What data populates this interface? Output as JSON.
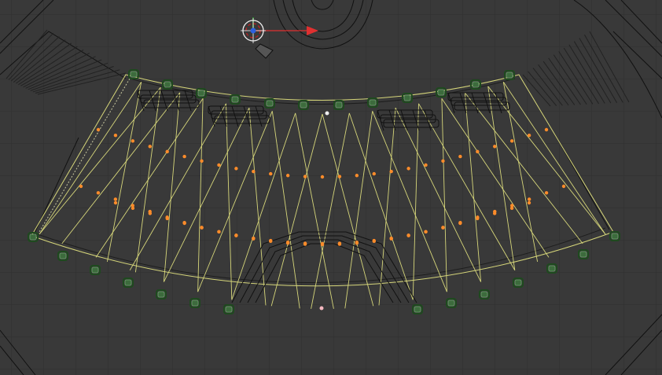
{
  "viewport": {
    "view_mode": "top-orthographic",
    "shading": "wireframe",
    "background_color": "#393939",
    "grid_color": "#313131",
    "wire_color": "#000000",
    "selection_color": "#d6d67a",
    "vertex_color": "#ff8c2a",
    "lamp_color": "#3d6b3d"
  },
  "gizmo": {
    "icon": "transform-manipulator-icon",
    "x_axis_color": "#e03030",
    "y_axis_color": "#30c030",
    "center_color": "#2c5fe0"
  },
  "objects": {
    "icons": [
      "camera-icon",
      "spot-lamp-icon",
      "stage-mesh-icon",
      "cursor-3d-icon"
    ]
  }
}
